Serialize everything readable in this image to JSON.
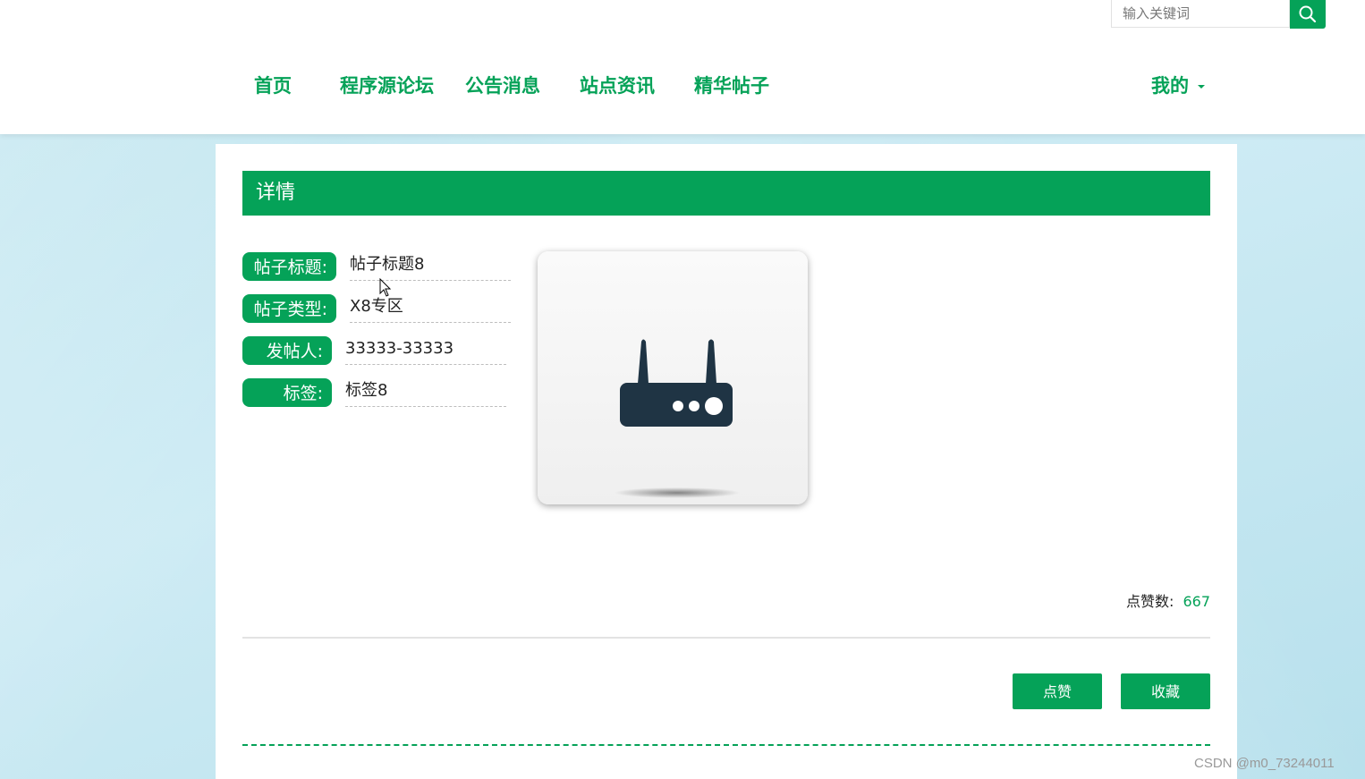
{
  "search": {
    "placeholder": "输入关键词"
  },
  "nav": {
    "items": [
      "首页",
      "程序源论坛",
      "公告消息",
      "站点资讯",
      "精华帖子"
    ],
    "user_menu": "我的"
  },
  "detail": {
    "heading": "详情",
    "fields": [
      {
        "label": "帖子标题:",
        "value": "帖子标题8"
      },
      {
        "label": "帖子类型:",
        "value": "X8专区"
      },
      {
        "label": "发帖人:",
        "value": "33333-33333"
      },
      {
        "label": "标签:",
        "value": "标签8"
      }
    ],
    "like_count_label": "点赞数:",
    "like_count": "667",
    "buttons": {
      "like": "点赞",
      "favorite": "收藏"
    }
  },
  "watermark": "CSDN @m0_73244011",
  "colors": {
    "accent": "#05a258",
    "background": "#c9e9f2"
  },
  "icons": [
    "search-icon",
    "router-icon",
    "caret-down-icon",
    "mouse-cursor-icon"
  ]
}
